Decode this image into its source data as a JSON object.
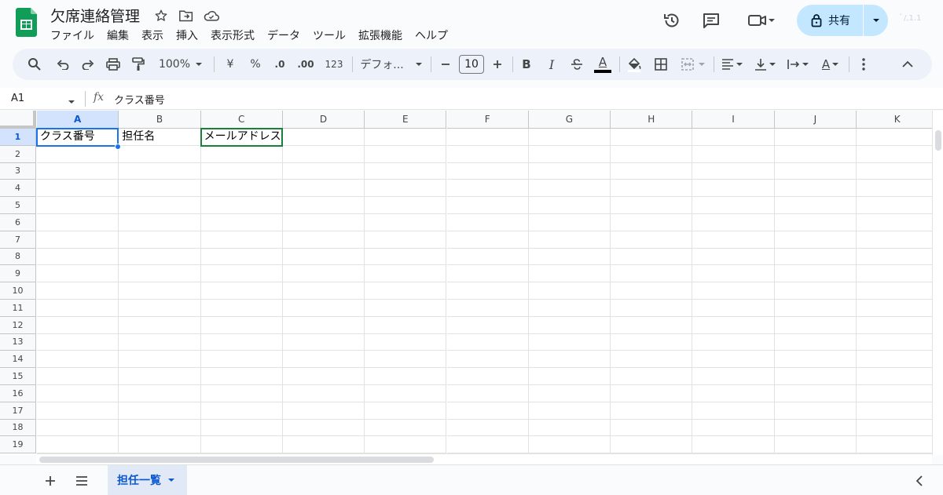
{
  "doc": {
    "title": "欠席連絡管理"
  },
  "title_icons": [
    "star-icon",
    "move-to-folder-icon",
    "cloud-saved-icon"
  ],
  "menu": [
    "ファイル",
    "編集",
    "表示",
    "挿入",
    "表示形式",
    "データ",
    "ツール",
    "拡張機能",
    "ヘルプ"
  ],
  "header_right": {
    "share_label": "共有",
    "avatar_text": "ﾞ/,1.1"
  },
  "toolbar": {
    "zoom": "100%",
    "currency": "¥",
    "percent": "%",
    "decrease_decimal": ".0",
    "increase_decimal": ".00",
    "number_format": "123",
    "font": "デフォ...",
    "font_size": "10",
    "bold": "B",
    "italic": "I",
    "text_color": "A",
    "rotate": "A"
  },
  "formula_bar": {
    "name_box": "A1",
    "fx_label": "fx",
    "content": "クラス番号"
  },
  "columns": [
    "A",
    "B",
    "C",
    "D",
    "E",
    "F",
    "G",
    "H",
    "I",
    "J",
    "K"
  ],
  "rows": [
    "1",
    "2",
    "3",
    "4",
    "5",
    "6",
    "7",
    "8",
    "9",
    "10",
    "11",
    "12",
    "13",
    "14",
    "15",
    "16",
    "17",
    "18",
    "19"
  ],
  "cells": {
    "A1": "クラス番号",
    "B1": "担任名",
    "C1": "メールアドレス"
  },
  "active_cell": "A1",
  "sheets": [
    {
      "name": "担任一覧",
      "active": true
    }
  ],
  "colors": {
    "accent": "#0b57d0",
    "selection": "#1a73e8",
    "share_bg": "#c2e7ff",
    "sheets_green": "#0f9d58",
    "green_border": "#188038"
  }
}
